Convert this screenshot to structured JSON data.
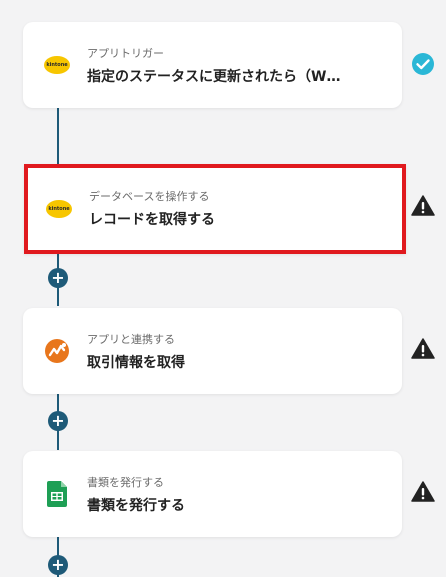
{
  "flow": {
    "steps": [
      {
        "kicker": "アプリトリガー",
        "title": "指定のステータスに更新されたら（W…",
        "logo": "kintone-logo",
        "logo_text": "kintone",
        "status": "check-circle-icon"
      },
      {
        "kicker": "データベースを操作する",
        "title": "レコードを取得する",
        "logo": "kintone-logo",
        "logo_text": "kintone",
        "status": "warning-icon"
      },
      {
        "kicker": "アプリと連携する",
        "title": "取引情報を取得",
        "logo": "freee-logo",
        "status": "warning-icon"
      },
      {
        "kicker": "書類を発行する",
        "title": "書類を発行する",
        "logo": "google-sheets-logo",
        "status": "warning-icon"
      }
    ],
    "add_step_symbol": "+"
  },
  "colors": {
    "connector": "#1e5a78",
    "check": "#2ab7d6",
    "warning": "#222222",
    "selected_border": "#e0191e",
    "kintone": "#f7c600",
    "freee_orange": "#e8761c",
    "sheets_green": "#1e9f55"
  }
}
